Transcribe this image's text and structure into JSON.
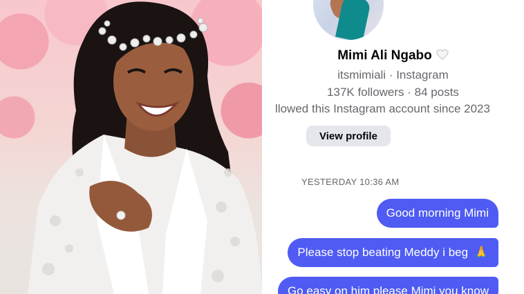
{
  "photo": {
    "description_icon": "bride-photo"
  },
  "profile": {
    "name": "Mimi Ali Ngabo",
    "handle_line": "itsmimiali · Instagram",
    "stats_line": "137K followers · 84 posts",
    "follow_line": "llowed this Instagram account since 2023",
    "view_profile_label": "View profile",
    "heart_icon": "white-heart-icon"
  },
  "conversation": {
    "timestamp": "YESTERDAY 10:36 AM",
    "messages": [
      {
        "text": "Good morning Mimi",
        "from": "me"
      },
      {
        "text": "Please stop beating Meddy i beg",
        "emoji": "🙏",
        "from": "me"
      },
      {
        "text": "Go easy on him please Mimi you know",
        "from": "me"
      }
    ]
  },
  "colors": {
    "bubble": "#4f5bf2",
    "secondary_text": "#65676b",
    "button_bg": "#e4e6eb"
  }
}
